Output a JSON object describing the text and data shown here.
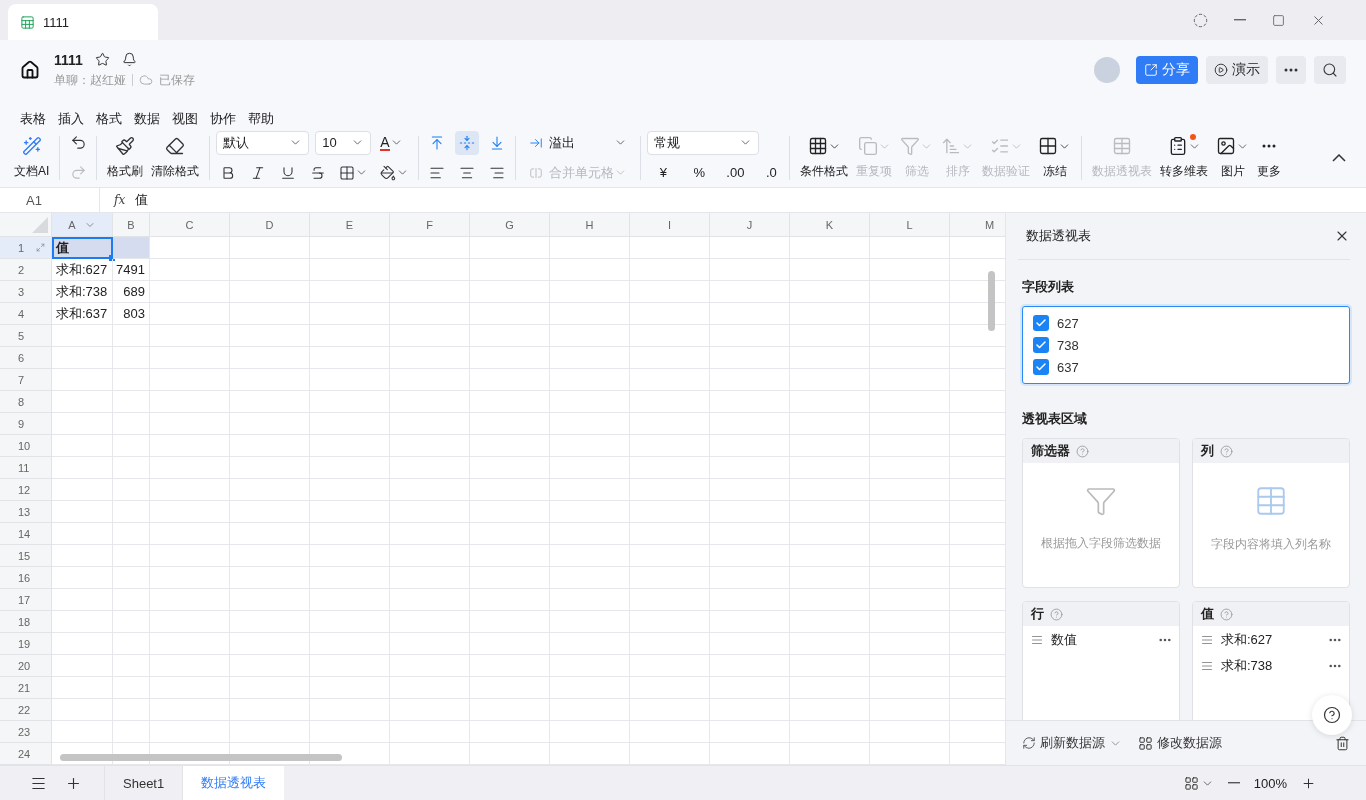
{
  "tab": {
    "title": "1111"
  },
  "header": {
    "title": "1111",
    "chat": "单聊：赵红娅",
    "save_status": "已保存",
    "share": "分享",
    "present": "演示"
  },
  "menu": [
    "表格",
    "插入",
    "格式",
    "数据",
    "视图",
    "协作",
    "帮助"
  ],
  "toolbar": {
    "ai": "文档AI",
    "undo": {
      "disabled": false
    },
    "redo": {
      "disabled": true
    },
    "painter": "格式刷",
    "clear": "清除格式",
    "font": "默认",
    "size": "10",
    "font_color": "A",
    "valign": [
      {
        "selected": false
      },
      {
        "selected": true
      },
      {
        "selected": false
      }
    ],
    "overflow": "溢出",
    "merge": {
      "label": "合并单元格",
      "disabled": true
    },
    "number_format": "常规",
    "currency": "¥",
    "percent": "%",
    "decimals": [
      ".00",
      ".0"
    ],
    "tools": [
      {
        "label": "条件格式",
        "disabled": false
      },
      {
        "label": "重复项",
        "disabled": true
      },
      {
        "label": "筛选",
        "disabled": true
      },
      {
        "label": "排序",
        "disabled": true
      },
      {
        "label": "数据验证",
        "disabled": true
      },
      {
        "label": "冻结",
        "disabled": false
      }
    ],
    "tools2": [
      {
        "label": "数据透视表",
        "disabled": true,
        "badge": false
      },
      {
        "label": "转多维表",
        "disabled": false,
        "badge": true
      },
      {
        "label": "图片",
        "disabled": false,
        "badge": false
      },
      {
        "label": "更多",
        "disabled": false,
        "badge": false
      }
    ]
  },
  "formula_bar": {
    "cell": "A1",
    "fx": "fx",
    "value": "值"
  },
  "sheet": {
    "columns": [
      {
        "label": "A",
        "selected": true
      },
      {
        "label": "B",
        "selected": false
      },
      {
        "label": "C",
        "selected": false
      },
      {
        "label": "D",
        "selected": false
      },
      {
        "label": "E",
        "selected": false
      },
      {
        "label": "F",
        "selected": false
      },
      {
        "label": "G",
        "selected": false
      },
      {
        "label": "H",
        "selected": false
      },
      {
        "label": "I",
        "selected": false
      },
      {
        "label": "J",
        "selected": false
      },
      {
        "label": "K",
        "selected": false
      },
      {
        "label": "L",
        "selected": false
      },
      {
        "label": "M",
        "selected": false
      }
    ],
    "rows": [
      {
        "label": "1",
        "selected": true,
        "cells": [
          {
            "text": "值",
            "kind": "text",
            "selected": true,
            "highlight": true
          },
          {
            "kind": "text",
            "selected": false,
            "highlight": true
          }
        ]
      },
      {
        "label": "2",
        "selected": false,
        "cells": [
          {
            "text": "求和:627",
            "kind": "text",
            "selected": false,
            "highlight": false
          },
          {
            "text": "7491",
            "kind": "number",
            "selected": false,
            "highlight": false
          }
        ]
      },
      {
        "label": "3",
        "selected": false,
        "cells": [
          {
            "text": "求和:738",
            "kind": "text",
            "selected": false,
            "highlight": false
          },
          {
            "text": "689",
            "kind": "number",
            "selected": false,
            "highlight": false
          }
        ]
      },
      {
        "label": "4",
        "selected": false,
        "cells": [
          {
            "text": "求和:637",
            "kind": "text",
            "selected": false,
            "highlight": false
          },
          {
            "text": "803",
            "kind": "number",
            "selected": false,
            "highlight": false
          }
        ]
      },
      {
        "label": "5",
        "selected": false
      },
      {
        "label": "6",
        "selected": false
      },
      {
        "label": "7",
        "selected": false
      },
      {
        "label": "8",
        "selected": false
      },
      {
        "label": "9",
        "selected": false
      },
      {
        "label": "10",
        "selected": false
      },
      {
        "label": "11",
        "selected": false
      },
      {
        "label": "12",
        "selected": false
      },
      {
        "label": "13",
        "selected": false
      },
      {
        "label": "14",
        "selected": false
      },
      {
        "label": "15",
        "selected": false
      },
      {
        "label": "16",
        "selected": false
      },
      {
        "label": "17",
        "selected": false
      },
      {
        "label": "18",
        "selected": false
      },
      {
        "label": "19",
        "selected": false
      },
      {
        "label": "20",
        "selected": false
      },
      {
        "label": "21",
        "selected": false
      },
      {
        "label": "22",
        "selected": false
      },
      {
        "label": "23",
        "selected": false
      },
      {
        "label": "24",
        "selected": false
      }
    ]
  },
  "sheet_tabs": [
    {
      "label": "Sheet1",
      "selected": false
    },
    {
      "label": "数据透视表",
      "selected": true
    }
  ],
  "panel": {
    "title": "数据透视表",
    "fields_title": "字段列表",
    "fields": [
      {
        "label": "627",
        "checked": true
      },
      {
        "label": "738",
        "checked": true
      },
      {
        "label": "637",
        "checked": true
      }
    ],
    "areas_title": "透视表区域",
    "areas": [
      {
        "title": "筛选器",
        "kind": "filter",
        "hint": "根据拖入字段筛选数据"
      },
      {
        "title": "列",
        "kind": "columns",
        "hint": "字段内容将填入列名称"
      },
      {
        "title": "行",
        "kind": "list",
        "items": [
          "数值"
        ]
      },
      {
        "title": "值",
        "kind": "list",
        "items": [
          "求和:627",
          "求和:738"
        ]
      }
    ],
    "refresh": "刷新数据源",
    "modify": "修改数据源"
  },
  "status": {
    "zoom": "100%"
  }
}
